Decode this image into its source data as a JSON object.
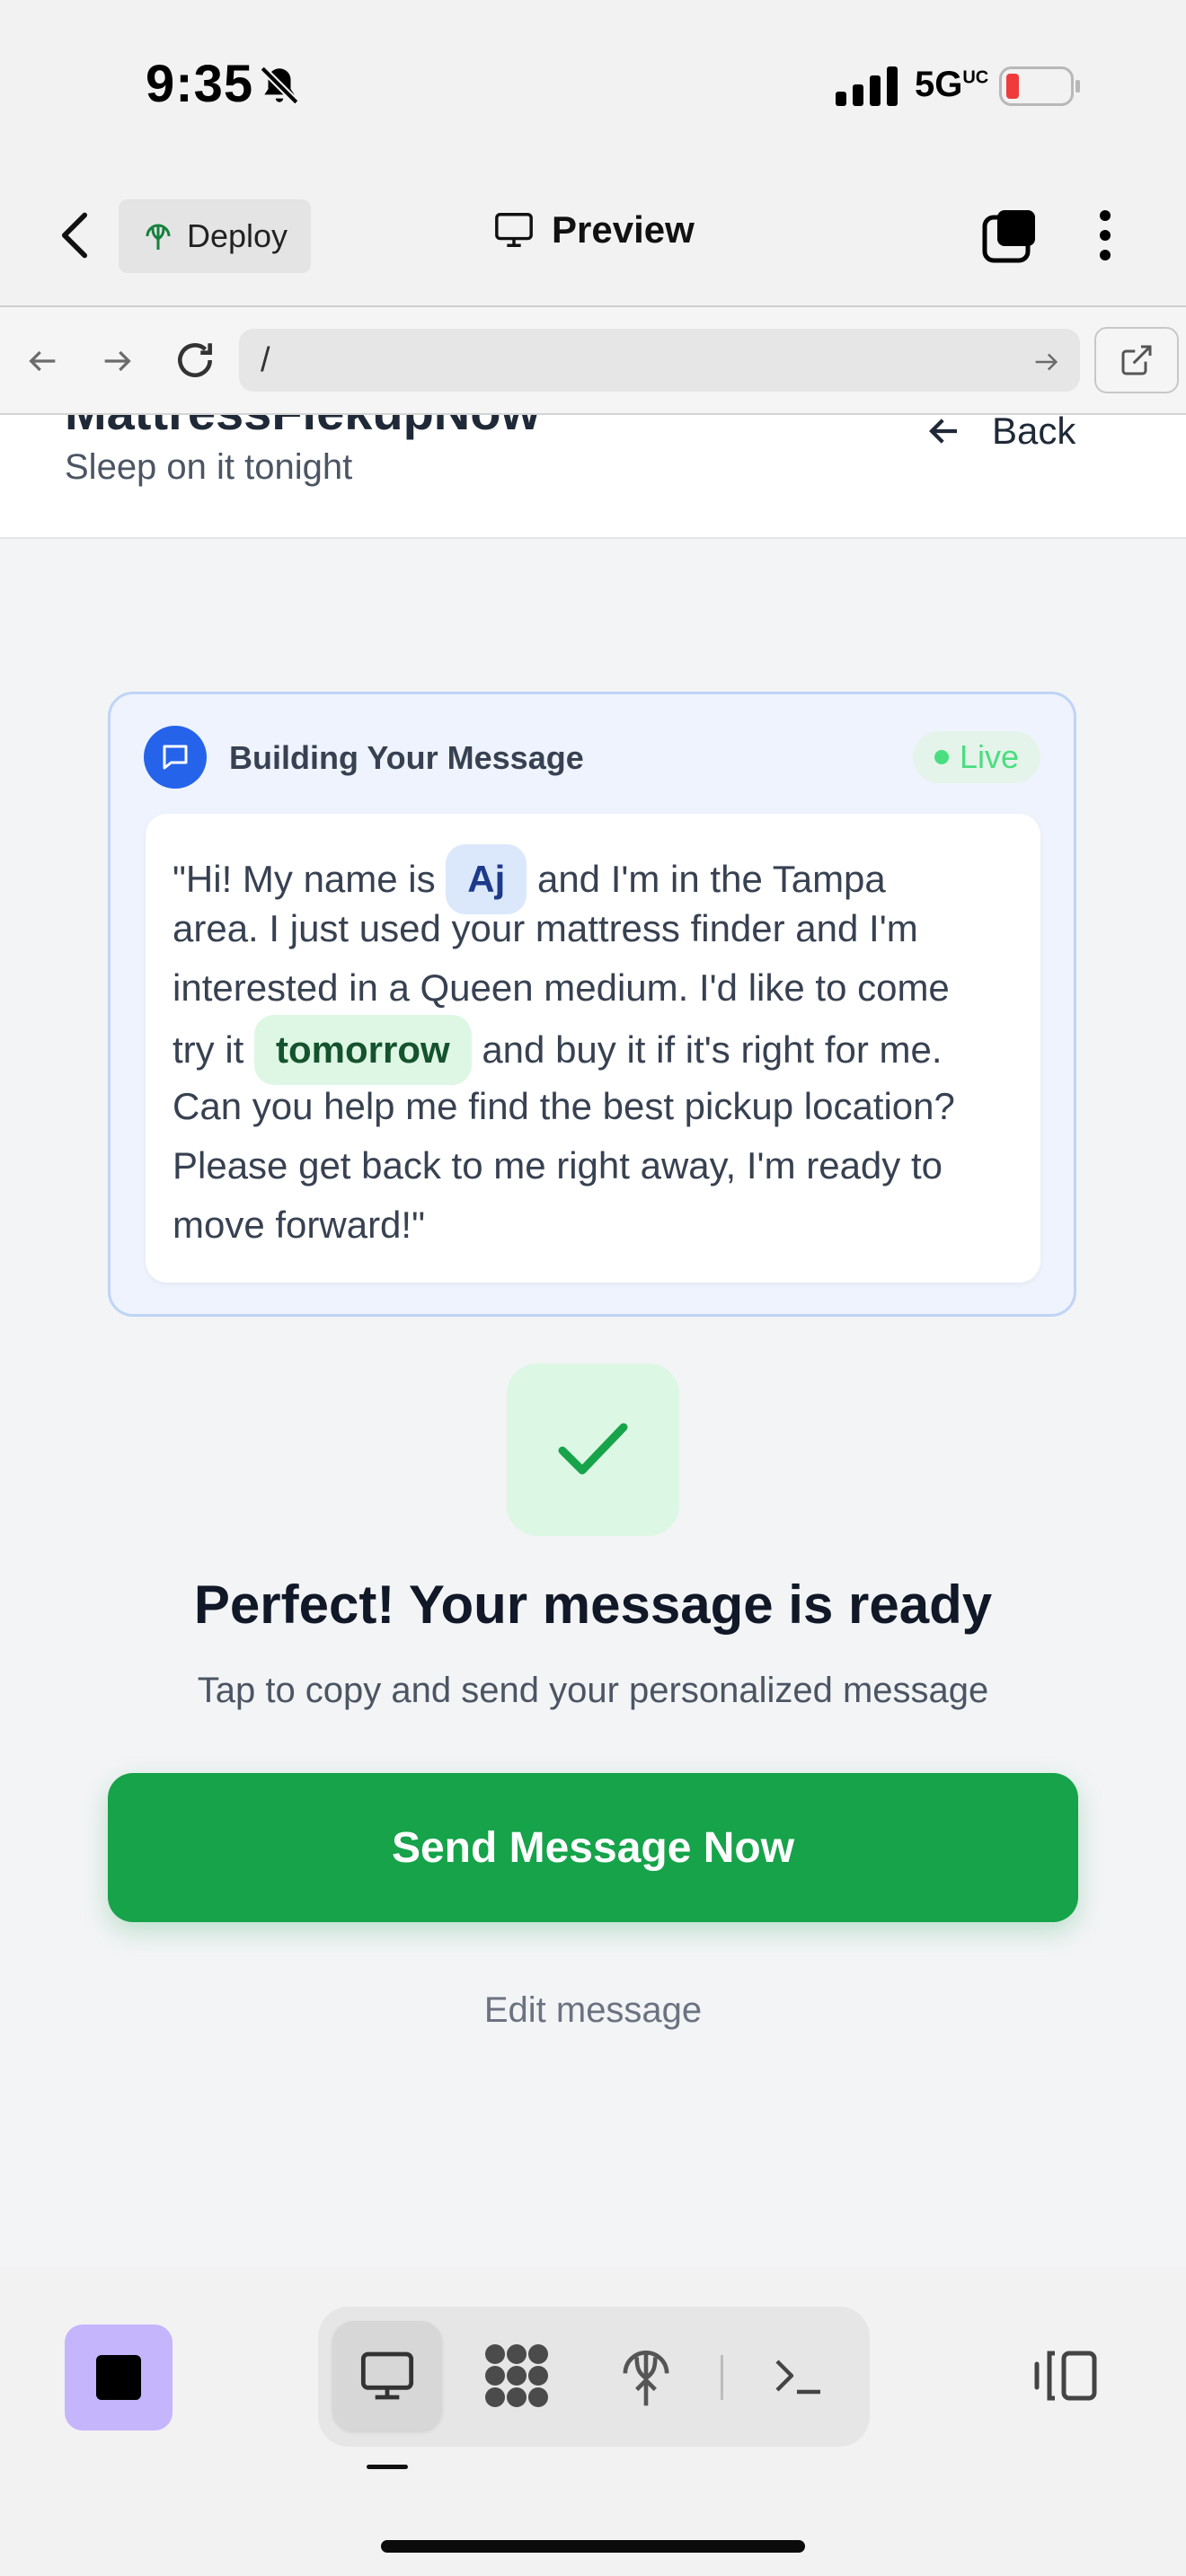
{
  "status_bar": {
    "time": "9:35",
    "network": "5G",
    "network_sup": "UC"
  },
  "app_header": {
    "deploy_label": "Deploy",
    "preview_label": "Preview"
  },
  "browser": {
    "url": "/"
  },
  "page_header": {
    "brand": "MattressFiekupNow",
    "tagline": "Sleep on it tonight",
    "back_label": "Back"
  },
  "message_card": {
    "title": "Building Your Message",
    "live_label": "Live",
    "lines": [
      {
        "pre": "\"Hi! My name is ",
        "chip": "Aj",
        "post": " and I'm in the Tampa"
      },
      {
        "text": "area. I just used your mattress finder and I'm"
      },
      {
        "text": "interested in a Queen medium. I'd like to come"
      },
      {
        "pre": "try it ",
        "chip": "tomorrow",
        "post": " and buy it if it's right for me."
      },
      {
        "text": "Can you help me find the best pickup location?"
      },
      {
        "text": "Please get back to me right away, I'm ready to"
      },
      {
        "text": "move forward!\""
      }
    ]
  },
  "result": {
    "title": "Perfect! Your message is ready",
    "subtitle": "Tap to copy and send your personalized message",
    "send_label": "Send Message Now",
    "edit_label": "Edit message"
  },
  "colors": {
    "accent_green": "#16a34a",
    "accent_blue": "#2563eb",
    "stop_purple": "#c4b5fd"
  },
  "icons": [
    "bell-slash-icon",
    "signal-icon",
    "battery-icon",
    "chevron-left-icon",
    "deploy-icon",
    "monitor-icon",
    "tabs-icon",
    "more-vertical-icon",
    "arrow-left-icon",
    "arrow-right-icon",
    "reload-icon",
    "external-link-icon",
    "chat-icon",
    "check-icon",
    "stop-icon",
    "grid-icon",
    "terminal-icon",
    "panel-icon"
  ]
}
